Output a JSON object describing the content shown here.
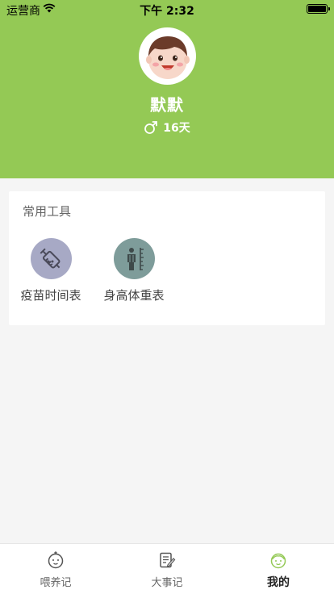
{
  "status_bar": {
    "carrier": "运营商",
    "time": "下午 2:32"
  },
  "profile": {
    "name": "默默",
    "gender_symbol": "♂",
    "age_days": "16天"
  },
  "tools": {
    "title": "常用工具",
    "items": [
      {
        "label": "疫苗时间表",
        "icon": "vaccine-syringe-icon",
        "color": "#a7a9c5"
      },
      {
        "label": "身高体重表",
        "icon": "height-measure-icon",
        "color": "#7e9c9a"
      }
    ]
  },
  "tabbar": {
    "tabs": [
      {
        "label": "喂养记",
        "icon": "baby-face-icon",
        "active": false
      },
      {
        "label": "大事记",
        "icon": "notes-edit-icon",
        "active": false
      },
      {
        "label": "我的",
        "icon": "baby-face-icon",
        "active": true
      }
    ]
  },
  "colors": {
    "header_green": "#94c955",
    "active_tab_icon": "#94c955"
  }
}
